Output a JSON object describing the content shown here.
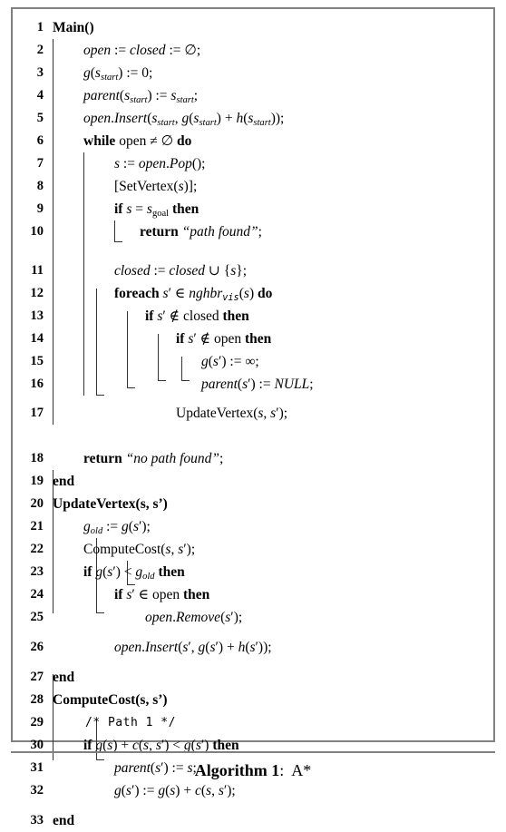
{
  "caption": {
    "label": "Algorithm 1",
    "separator": ":",
    "name": "A*"
  },
  "colors": {
    "frame_border": "#808080",
    "rule": "#333333",
    "background": "#ffffff",
    "text": "#000000"
  },
  "algorithm": {
    "title": "Main()",
    "line_count": 33,
    "lines": [
      {
        "n": "1",
        "text": "Main()"
      },
      {
        "n": "2",
        "text": "open := closed := ∅;"
      },
      {
        "n": "3",
        "text": "g(s_start) := 0;"
      },
      {
        "n": "4",
        "text": "parent(s_start) := s_start;"
      },
      {
        "n": "5",
        "text": "open.Insert(s_start, g(s_start) + h(s_start));"
      },
      {
        "n": "6",
        "text": "while open ≠ ∅ do"
      },
      {
        "n": "7",
        "text": "s := open.Pop();"
      },
      {
        "n": "8",
        "text": "[SetVertex(s)];"
      },
      {
        "n": "9",
        "text": "if s = s_goal then"
      },
      {
        "n": "10",
        "text": "return “path found”;"
      },
      {
        "n": "11",
        "text": "closed := closed ∪ {s};"
      },
      {
        "n": "12",
        "text": "foreach s′ ∈ nghbr_vis(s) do"
      },
      {
        "n": "13",
        "text": "if s′ ∉ closed then"
      },
      {
        "n": "14",
        "text": "if s′ ∉ open then"
      },
      {
        "n": "15",
        "text": "g(s′) := ∞;"
      },
      {
        "n": "16",
        "text": "parent(s′) := NULL;"
      },
      {
        "n": "17",
        "text": "UpdateVertex(s, s′);"
      },
      {
        "n": "18",
        "text": "return “no path found”;"
      },
      {
        "n": "19",
        "text": "end"
      },
      {
        "n": "20",
        "text": "UpdateVertex(s, s’)"
      },
      {
        "n": "21",
        "text": "g_old := g(s′);"
      },
      {
        "n": "22",
        "text": "ComputeCost(s, s′);"
      },
      {
        "n": "23",
        "text": "if g(s′) < g_old then"
      },
      {
        "n": "24",
        "text": "if s′ ∈ open then"
      },
      {
        "n": "25",
        "text": "open.Remove(s′);"
      },
      {
        "n": "26",
        "text": "open.Insert(s′, g(s′) + h(s′));"
      },
      {
        "n": "27",
        "text": "end"
      },
      {
        "n": "28",
        "text": "ComputeCost(s, s’)"
      },
      {
        "n": "29",
        "text": "/* Path 1 */"
      },
      {
        "n": "30",
        "text": "if g(s) + c(s, s′) < g(s′) then"
      },
      {
        "n": "31",
        "text": "parent(s′) := s;"
      },
      {
        "n": "32",
        "text": "g(s′) := g(s) + c(s, s′);"
      },
      {
        "n": "33",
        "text": "end"
      }
    ],
    "procedures": [
      "Main()",
      "UpdateVertex(s, s’)",
      "ComputeCost(s, s’)"
    ],
    "keywords": [
      "while",
      "do",
      "if",
      "then",
      "foreach",
      "return",
      "end"
    ],
    "literals": [
      "“path found”",
      "“no path found”",
      "NULL",
      "0",
      "∞"
    ],
    "comment": "/* Path 1 */"
  }
}
